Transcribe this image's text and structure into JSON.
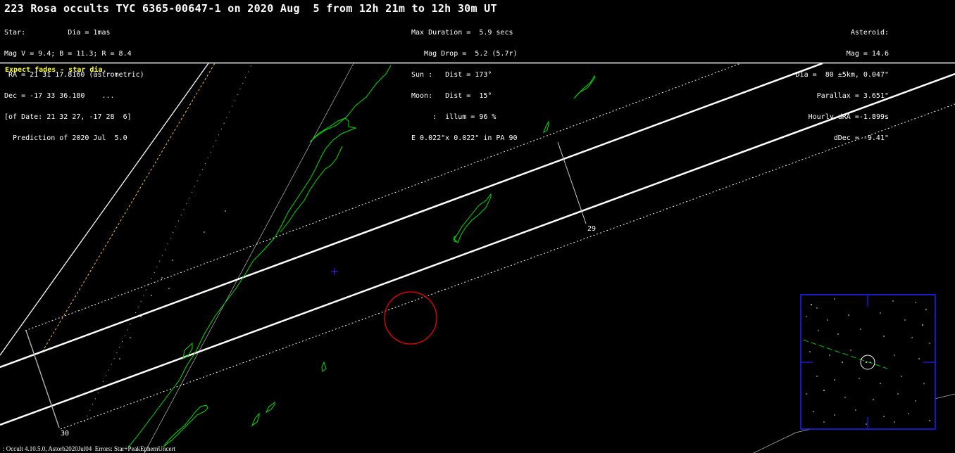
{
  "title": "223 Rosa occults TYC 6365-00647-1 on 2020 Aug  5 from 12h 21m to 12h 30m UT",
  "star_block": [
    "Star:          Dia = 1mas",
    "Mag V = 9.4; B = 11.3; R = 8.4",
    " RA = 21 31 17.8160 (astrometric)",
    "Dec = -17 33 36.180    ...",
    "[of Date: 21 32 27, -17 28  6]",
    "  Prediction of 2020 Jul  5.0"
  ],
  "event_block": [
    "Max Duration =  5.9 secs",
    "   Mag Drop =  5.2 (5.7r)",
    "Sun :   Dist = 173°",
    "Moon:   Dist =  15°",
    "     :  illum = 96 %",
    "E 0.022\"x 0.022\" in PA 90"
  ],
  "asteroid_block": [
    "Asteroid:",
    "Mag = 14.6",
    "Dia =  80 ±5km, 0.047\"",
    "Parallax = 3.651\"",
    "Hourly dRA =-1.899s",
    "dDec = -9.41\""
  ],
  "note": "Expect fades - star dia.",
  "footer": ": Occult 4.10.5.0, Astorb2020Jul04  Errors: Star+PeakEphemUncert",
  "map_labels": {
    "time_29": "29",
    "time_30": "30"
  },
  "colors": {
    "path_lines": "#ffffff",
    "coastline": "#00e000",
    "observer_circle": "#ff0000",
    "center_marker": "#3030ff",
    "inset_frame": "#2020ff",
    "note_text": "#ffff40",
    "sun_terminator": "#ffc040"
  }
}
